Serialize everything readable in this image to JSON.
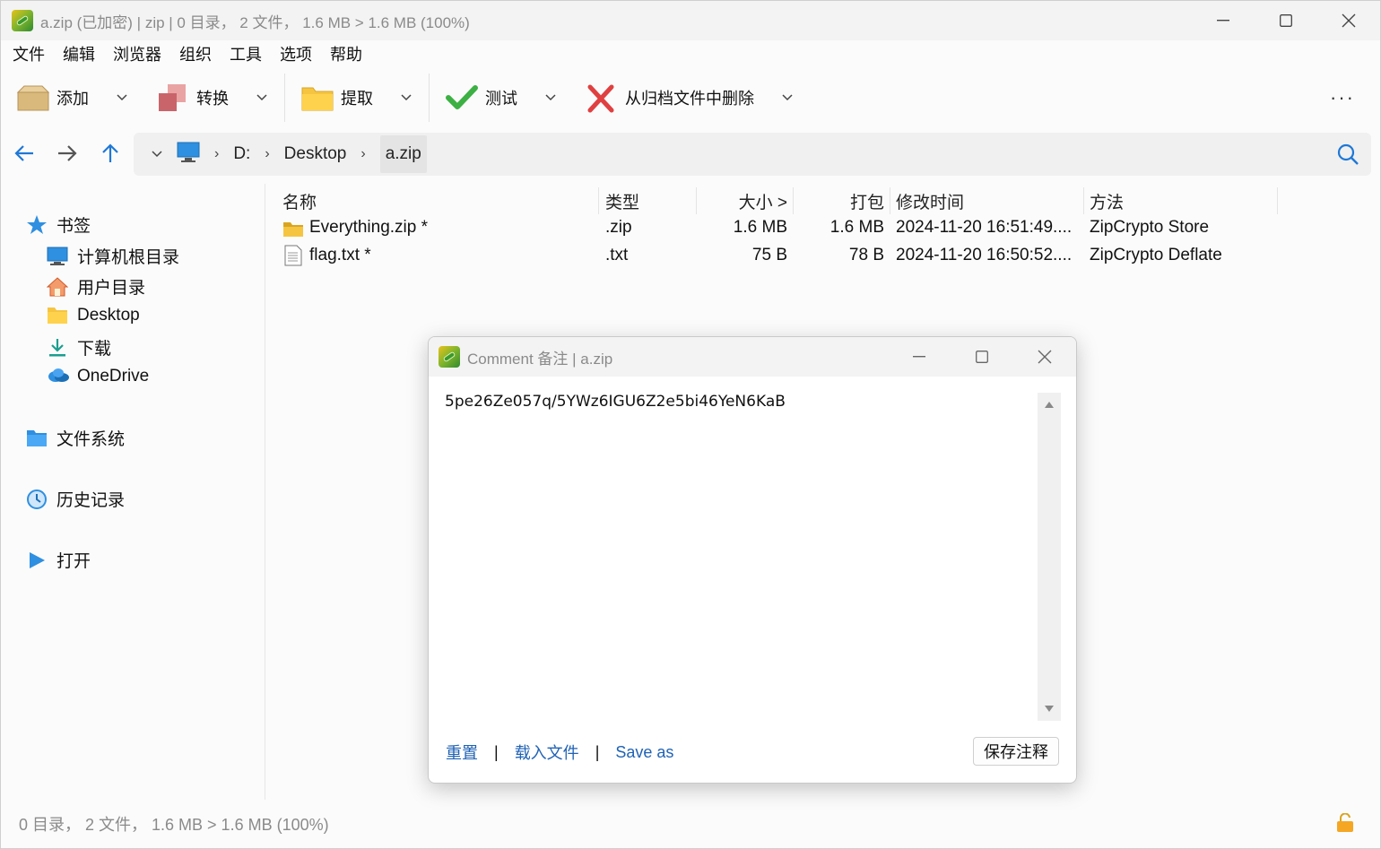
{
  "window": {
    "title": "a.zip (已加密) | zip | 0 目录， 2 文件， 1.6 MB > 1.6 MB (100%)"
  },
  "menu": [
    "文件",
    "编辑",
    "浏览器",
    "组织",
    "工具",
    "选项",
    "帮助"
  ],
  "toolbar": {
    "add": "添加",
    "convert": "转换",
    "extract": "提取",
    "test": "测试",
    "delete": "从归档文件中删除",
    "more": "···"
  },
  "address": {
    "segments": [
      "D:",
      "Desktop",
      "a.zip"
    ]
  },
  "sidebar": {
    "bookmarks": "书签",
    "items": [
      "计算机根目录",
      "用户目录",
      "Desktop",
      "下载",
      "OneDrive"
    ],
    "filesystem": "文件系统",
    "history": "历史记录",
    "open": "打开"
  },
  "columns": {
    "name": "名称",
    "type": "类型",
    "size": "大小 >",
    "packed": "打包",
    "modified": "修改时间",
    "method": "方法"
  },
  "files": [
    {
      "name": "Everything.zip *",
      "type": ".zip",
      "size": "1.6 MB",
      "packed": "1.6 MB",
      "modified": "2024-11-20 16:51:49....",
      "method": "ZipCrypto Store",
      "icon": "zip-folder-icon"
    },
    {
      "name": "flag.txt *",
      "type": ".txt",
      "size": "75 B",
      "packed": "78 B",
      "modified": "2024-11-20 16:50:52....",
      "method": "ZipCrypto Deflate",
      "icon": "text-file-icon"
    }
  ],
  "status": {
    "text": "0 目录， 2 文件， 1.6 MB > 1.6 MB (100%)"
  },
  "dialog": {
    "title": "Comment 备注 | a.zip",
    "comment": "5pe26Ze057q/5YWz6IGU6Z2e5bi46YeN6KaB",
    "reset": "重置",
    "load_file": "载入文件",
    "save_as": "Save as",
    "save_comment": "保存注释"
  },
  "colors": {
    "link": "#1f62b5",
    "accent_blue": "#1e90ff",
    "folder_yellow": "#f5c542"
  }
}
